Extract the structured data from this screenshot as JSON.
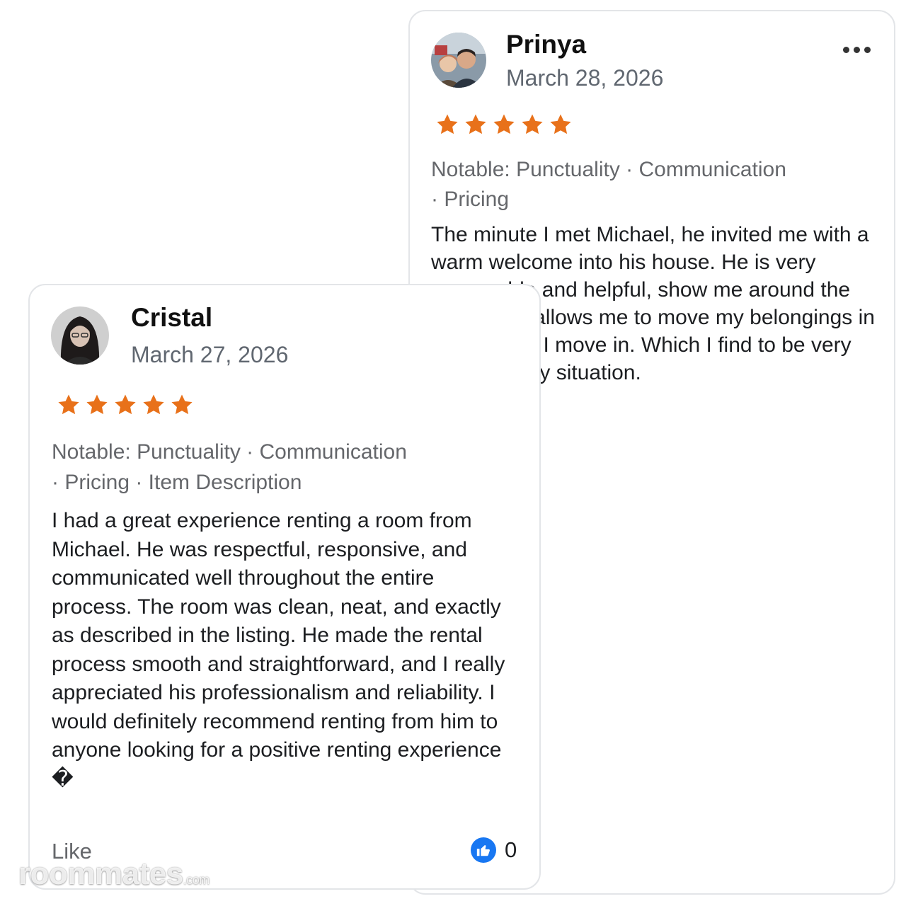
{
  "reviews": [
    {
      "name": "Prinya",
      "date": "March 28, 2026",
      "rating": 5,
      "notable_line1": "Notable: Punctuality · Communication",
      "notable_line2": "· Pricing",
      "body": "The minute I met Michael, he invited me with a warm welcome into his house. He is very personable and helpful, show me around the house. He allows me to move my belongings in long before I move in. Which I find to be very helpful in my situation.",
      "avatar_icon": "couple-photo-avatar",
      "menu_icon": "more-options-icon"
    },
    {
      "name": "Cristal",
      "date": "March 27, 2026",
      "rating": 5,
      "notable_line1": "Notable: Punctuality · Communication",
      "notable_line2": "· Pricing · Item Description",
      "body": "I had a great experience renting a room from Michael. He was respectful, responsive, and communicated well throughout the entire process. The room was clean, neat, and exactly as described in the listing. He made the rental process smooth and straightforward, and I really appreciated his professionalism and reliability. I would definitely recommend renting from him to anyone looking for a positive renting experience �",
      "avatar_icon": "woman-photo-avatar",
      "like_label": "Like",
      "like_count": "0",
      "like_icon": "thumbs-up-icon"
    }
  ],
  "colors": {
    "star": "#e8711a",
    "like_blue": "#1877f2"
  },
  "watermark": {
    "brand": "roommates",
    "suffix": ".com"
  }
}
